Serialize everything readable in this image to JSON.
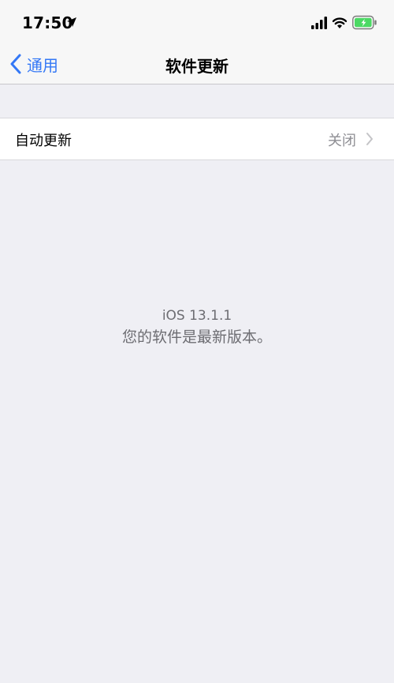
{
  "status_bar": {
    "time": "17:50",
    "icons": [
      "location-icon",
      "signal-icon",
      "wifi-icon",
      "battery-icon"
    ]
  },
  "nav": {
    "back_label": "通用",
    "title": "软件更新"
  },
  "settings": {
    "auto_update": {
      "label": "自动更新",
      "value": "关闭"
    }
  },
  "info": {
    "version": "iOS 13.1.1",
    "message": "您的软件是最新版本。"
  },
  "colors": {
    "accent": "#3478f6",
    "background": "#efeff4",
    "secondary_text": "#8e8e93",
    "battery": "#4cd964"
  }
}
